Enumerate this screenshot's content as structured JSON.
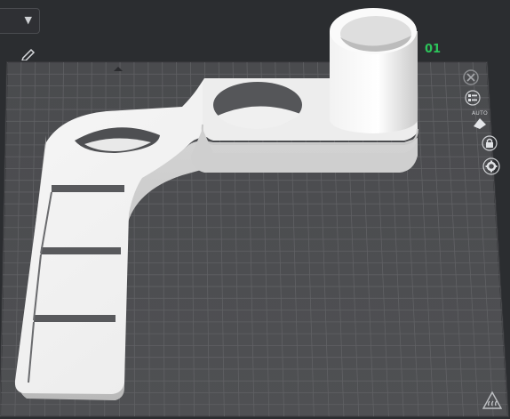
{
  "toolbar": {
    "dropdown_icon": "chevron-down-icon",
    "edit_icon": "pencil-icon"
  },
  "overlay": {
    "readout": "01"
  },
  "side_tools": [
    {
      "name": "close-icon"
    },
    {
      "name": "list-icon"
    },
    {
      "name": "auto-orient-icon",
      "label": "AUTO"
    },
    {
      "name": "lock-icon"
    },
    {
      "name": "gear-icon"
    }
  ],
  "footer": {
    "icon": "heatbed-warning-icon"
  },
  "colors": {
    "bed": "#4b4c4f",
    "grid": "#5d5e61",
    "model": "#e6e6e6",
    "accent_green": "#2cc45a"
  }
}
